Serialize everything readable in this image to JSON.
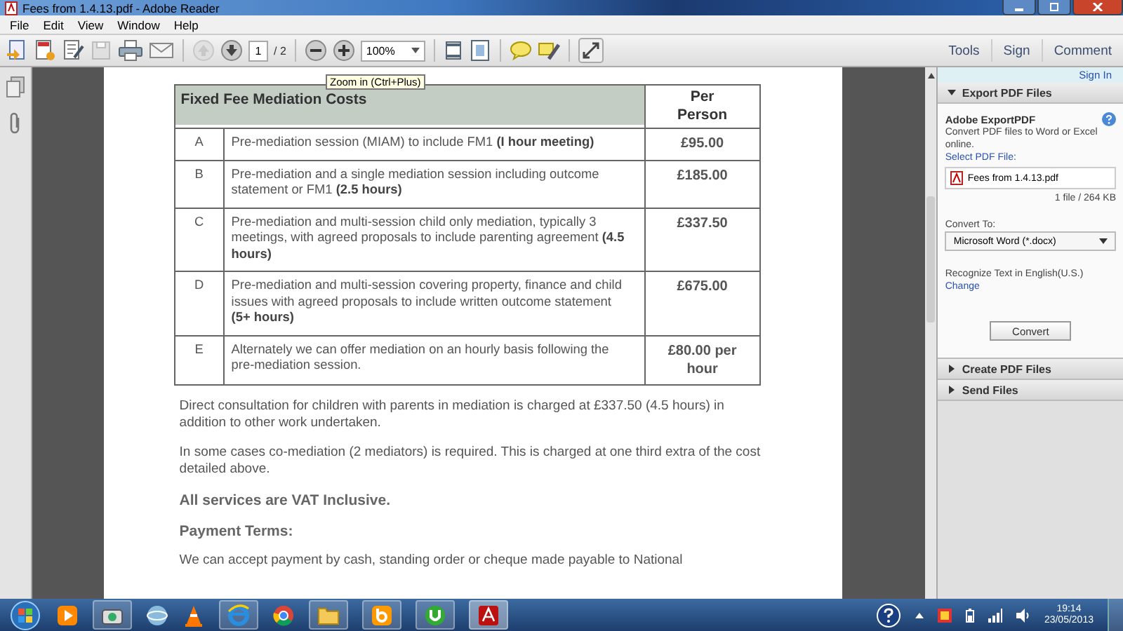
{
  "window": {
    "title": "Fees from 1.4.13.pdf - Adobe Reader"
  },
  "menu": [
    "File",
    "Edit",
    "View",
    "Window",
    "Help"
  ],
  "toolbar": {
    "page_value": "1",
    "page_total": "/ 2",
    "zoom_value": "100%",
    "tooltip": "Zoom in (Ctrl+Plus)",
    "tabs": [
      "Tools",
      "Sign",
      "Comment"
    ]
  },
  "document": {
    "table": {
      "columns": [
        "Fixed Fee Mediation Costs",
        "Per Person"
      ],
      "rows": [
        {
          "letter": "A",
          "text": "Pre-mediation session (MIAM) to include FM1 **(I hour meeting)**",
          "price": "£95.00"
        },
        {
          "letter": "B",
          "text": "Pre-mediation and a single mediation session including outcome statement or FM1 **(2.5 hours)**",
          "price": "£185.00"
        },
        {
          "letter": "C",
          "text": "Pre-mediation and multi-session child only mediation, typically 3 meetings, with agreed proposals to include parenting agreement **(4.5 hours)**",
          "price": "£337.50"
        },
        {
          "letter": "D",
          "text": "Pre-mediation and multi-session covering property, finance and child issues with agreed proposals to include written outcome statement **(5+ hours)**",
          "price": "£675.00"
        },
        {
          "letter": "E",
          "text": "Alternately we can offer mediation on an hourly basis following the pre-mediation session.",
          "price": "£80.00 per hour"
        }
      ]
    },
    "paragraphs": [
      {
        "kind": "text",
        "text": "Direct consultation for children with parents in mediation is charged at £337.50 (4.5 hours) in addition to other work undertaken."
      },
      {
        "kind": "text",
        "text": "In some cases co-mediation (2 mediators) is required.  This is charged at one third extra of the cost detailed above."
      },
      {
        "kind": "heading",
        "text": "All services are VAT Inclusive."
      },
      {
        "kind": "heading",
        "text": "Payment Terms:"
      },
      {
        "kind": "text",
        "text": "We can accept payment by cash, standing order or cheque made payable to National"
      }
    ]
  },
  "right_panel": {
    "sign_in": "Sign In",
    "sections": [
      {
        "title": "Export PDF Files",
        "expanded": true
      },
      {
        "title": "Create PDF Files",
        "expanded": false
      },
      {
        "title": "Send Files",
        "expanded": false
      }
    ],
    "export": {
      "heading": "Adobe ExportPDF",
      "description": "Convert PDF files to Word or Excel online.",
      "select_label": "Select PDF File:",
      "file": "Fees from 1.4.13.pdf",
      "file_info": "1 file / 264 KB",
      "convert_label": "Convert To:",
      "format": "Microsoft Word (*.docx)",
      "recognize": "Recognize Text in English(U.S.)",
      "change": "Change",
      "button": "Convert"
    }
  },
  "taskbar": {
    "time": "19:14",
    "date": "23/05/2013"
  }
}
